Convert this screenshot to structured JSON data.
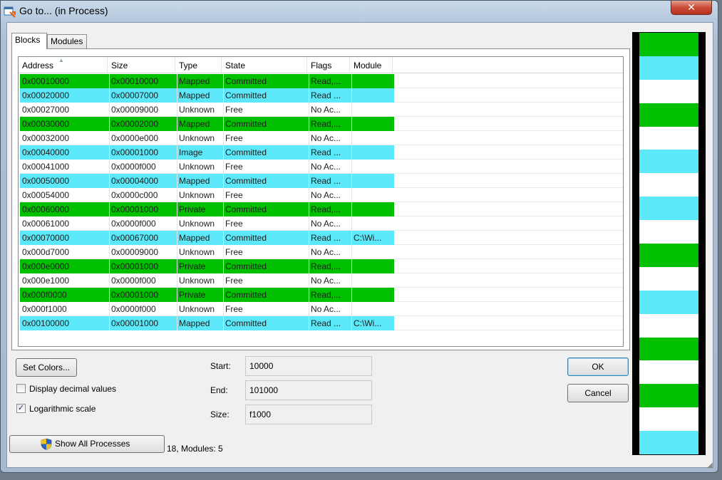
{
  "window": {
    "title": "Go to... (in Process)",
    "close_label": "✕"
  },
  "colors": {
    "green": "#00c000",
    "cyan": "#5ce8f8",
    "white": "#ffffff"
  },
  "tabs": [
    {
      "label": "Blocks",
      "active": true
    },
    {
      "label": "Modules",
      "active": false
    }
  ],
  "table": {
    "columns": [
      "Address",
      "Size",
      "Type",
      "State",
      "Flags",
      "Module"
    ],
    "rows": [
      {
        "color": "green",
        "cells": [
          "0x00010000",
          "0x00010000",
          "Mapped",
          "Committed",
          "Read,...",
          ""
        ]
      },
      {
        "color": "cyan",
        "cells": [
          "0x00020000",
          "0x00007000",
          "Mapped",
          "Committed",
          "Read ...",
          ""
        ]
      },
      {
        "color": "white",
        "cells": [
          "0x00027000",
          "0x00009000",
          "Unknown",
          "Free",
          "No Ac...",
          ""
        ]
      },
      {
        "color": "green",
        "cells": [
          "0x00030000",
          "0x00002000",
          "Mapped",
          "Committed",
          "Read,...",
          ""
        ]
      },
      {
        "color": "white",
        "cells": [
          "0x00032000",
          "0x0000e000",
          "Unknown",
          "Free",
          "No Ac...",
          ""
        ]
      },
      {
        "color": "cyan",
        "cells": [
          "0x00040000",
          "0x00001000",
          "Image",
          "Committed",
          "Read ...",
          ""
        ]
      },
      {
        "color": "white",
        "cells": [
          "0x00041000",
          "0x0000f000",
          "Unknown",
          "Free",
          "No Ac...",
          ""
        ]
      },
      {
        "color": "cyan",
        "cells": [
          "0x00050000",
          "0x00004000",
          "Mapped",
          "Committed",
          "Read ...",
          ""
        ]
      },
      {
        "color": "white",
        "cells": [
          "0x00054000",
          "0x0000c000",
          "Unknown",
          "Free",
          "No Ac...",
          ""
        ]
      },
      {
        "color": "green",
        "cells": [
          "0x00060000",
          "0x00001000",
          "Private",
          "Committed",
          "Read,...",
          ""
        ]
      },
      {
        "color": "white",
        "cells": [
          "0x00061000",
          "0x0000f000",
          "Unknown",
          "Free",
          "No Ac...",
          ""
        ]
      },
      {
        "color": "cyan",
        "cells": [
          "0x00070000",
          "0x00067000",
          "Mapped",
          "Committed",
          "Read ...",
          "C:\\Wi..."
        ]
      },
      {
        "color": "white",
        "cells": [
          "0x000d7000",
          "0x00009000",
          "Unknown",
          "Free",
          "No Ac...",
          ""
        ]
      },
      {
        "color": "green",
        "cells": [
          "0x000e0000",
          "0x00001000",
          "Private",
          "Committed",
          "Read,...",
          ""
        ]
      },
      {
        "color": "white",
        "cells": [
          "0x000e1000",
          "0x0000f000",
          "Unknown",
          "Free",
          "No Ac...",
          ""
        ]
      },
      {
        "color": "green",
        "cells": [
          "0x000f0000",
          "0x00001000",
          "Private",
          "Committed",
          "Read,...",
          ""
        ]
      },
      {
        "color": "white",
        "cells": [
          "0x000f1000",
          "0x0000f000",
          "Unknown",
          "Free",
          "No Ac...",
          ""
        ]
      },
      {
        "color": "cyan",
        "cells": [
          "0x00100000",
          "0x00001000",
          "Mapped",
          "Committed",
          "Read ...",
          "C:\\Wi..."
        ]
      }
    ]
  },
  "controls": {
    "set_colors_label": "Set Colors...",
    "display_decimal_label": "Display decimal values",
    "display_decimal_checked": false,
    "log_scale_label": "Logarithmic scale",
    "log_scale_checked": true,
    "show_all_label": "Show All Processes",
    "status_text": "18, Modules: 5",
    "ok_label": "OK",
    "cancel_label": "Cancel"
  },
  "range": {
    "start_label": "Start:",
    "start_value": "10000",
    "end_label": "End:",
    "end_value": "101000",
    "size_label": "Size:",
    "size_value": "f1000"
  },
  "map_segments": [
    "green",
    "cyan",
    "white",
    "green",
    "white",
    "cyan",
    "white",
    "cyan",
    "white",
    "green",
    "white",
    "cyan",
    "white",
    "green",
    "white",
    "green",
    "white",
    "cyan"
  ],
  "icons": {
    "title": "window-app-icon",
    "shield": "uac-shield-icon"
  }
}
